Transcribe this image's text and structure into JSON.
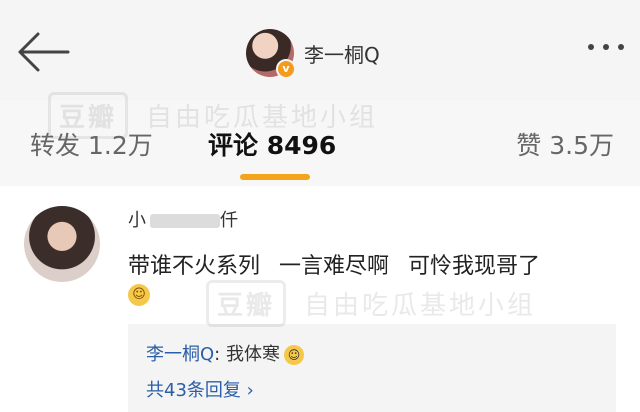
{
  "header": {
    "profile_name": "李一桐Q",
    "verified_badge": "v",
    "back_icon": "back-arrow-icon",
    "more_icon": "more-dots-icon"
  },
  "tabs": {
    "repost_label": "转发",
    "repost_count": "1.2万",
    "comments_label": "评论",
    "comments_count": "8496",
    "likes_label": "赞",
    "likes_count": "3.5万",
    "active_color": "#f4a31c"
  },
  "watermark": {
    "logo": "豆瓣",
    "text": "自由吃瓜基地小组"
  },
  "comment": {
    "username": "小",
    "username_suffix": "仟",
    "text": "带谁不火系列 一言难尽啊 可怜我现哥了",
    "emoji_icon": "laughing-emoji-icon",
    "reply": {
      "author": "李一桐Q",
      "separator": ":",
      "text": "我体寒",
      "emoji_icon": "sweat-emoji-icon",
      "count_label": "共43条回复",
      "chevron": "›"
    }
  }
}
